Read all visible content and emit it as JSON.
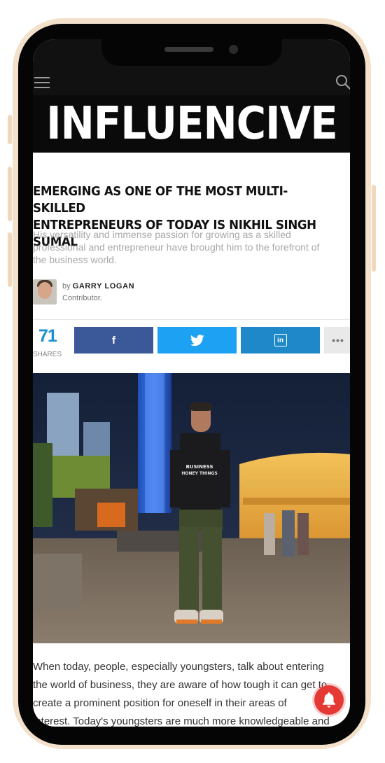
{
  "site": {
    "logo_text": "INFLUENCIVE"
  },
  "article": {
    "headline_line1": "EMERGING AS ONE OF THE MOST MULTI-SKILLED",
    "headline_line2": "ENTREPRENEURS OF TODAY IS NIKHIL SINGH SUMAL",
    "subhead_line1": "His versatility and immense passion for growing as a skilled",
    "subhead_line2": "professional and entrepreneur have brought him to the forefront of",
    "subhead_line3": "the business world.",
    "author_by": "by",
    "author_name": "GARRY LOGAN",
    "author_role": "Contributor.",
    "body_line1": "When today, people, especially youngsters, talk about entering",
    "body_line2": "the world of business, they are aware of how tough it can get to",
    "body_line3": "create a prominent position for oneself in their areas of",
    "body_line4": "interest. Today's youngsters are much more knowledgeable and"
  },
  "share": {
    "count": "71",
    "label": "SHARES",
    "facebook_icon": "f",
    "linkedin_icon": "in",
    "more_icon": "•••"
  },
  "hero_image": {
    "shirt_text_line1": "BUSINESS",
    "shirt_text_line2": "HONEY THINGS"
  },
  "colors": {
    "facebook": "#3b5998",
    "twitter": "#1da1f2",
    "linkedin": "#1e88c8",
    "share_count": "#1b8fd0",
    "notify": "#e53935"
  },
  "icons": [
    "menu-icon",
    "search-icon",
    "facebook-icon",
    "twitter-icon",
    "linkedin-icon",
    "more-icon",
    "bell-icon"
  ]
}
